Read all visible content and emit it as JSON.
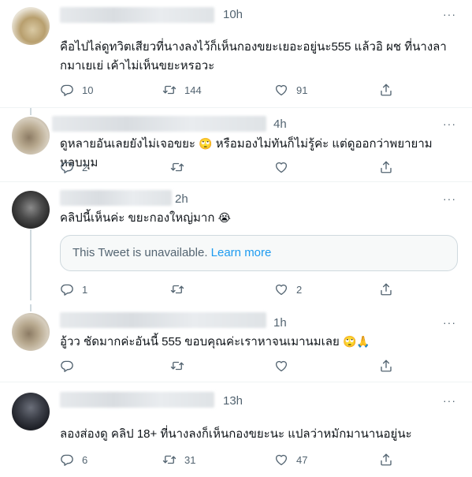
{
  "tweets": [
    {
      "time": "10h",
      "more": "···",
      "text": "คือไปไล่ดูทวิตเสียวที่นางลงไว้ก็เห็นกองขยะเยอะอยู่นะ555 แล้วอิ ผช ที่นางลากมาเยเย่ เค้าไม่เห็นขยะหรอวะ",
      "replies": "10",
      "retweets": "144",
      "likes": "91"
    },
    {
      "time": "4h",
      "more": "···",
      "text": "ดูหลายอันเลยยังไม่เจอขยะ",
      "emoji1": "🙄",
      "text2": "หรือมองไม่ทันก็ไม่รู้ค่ะ แต่ดูออกว่าพยายามหลบมุม",
      "replies": "2",
      "retweets": "",
      "likes": ""
    },
    {
      "time": "2h",
      "more": "···",
      "text": "คลิปนี้เห็นค่ะ ขยะกองใหญ่มาก",
      "emoji1": "😭",
      "quote_text": "This Tweet is unavailable.",
      "quote_link": "Learn more",
      "replies": "1",
      "retweets": "",
      "likes": "2"
    },
    {
      "time": "1h",
      "more": "···",
      "text": "อู้วว ชัดมากค่ะอันนี้ 555 ขอบคุณค่ะเราหาจนเมานมเลย",
      "emoji1": "🙄🙏",
      "replies": "",
      "retweets": "",
      "likes": ""
    },
    {
      "time": "13h",
      "more": "···",
      "text": "ลองส่องดู คลิป 18+ ที่นางลงก็เห็นกองขยะนะ แปลว่าหมักมานานอยู่นะ",
      "replies": "6",
      "retweets": "31",
      "likes": "47"
    }
  ],
  "icons": {
    "reply": "reply-icon",
    "retweet": "retweet-icon",
    "like": "heart-icon",
    "share": "share-icon",
    "more": "more-icon"
  },
  "colors": {
    "link": "#1d9bf0",
    "muted": "#536471",
    "thread_line": "#cfd9de"
  }
}
